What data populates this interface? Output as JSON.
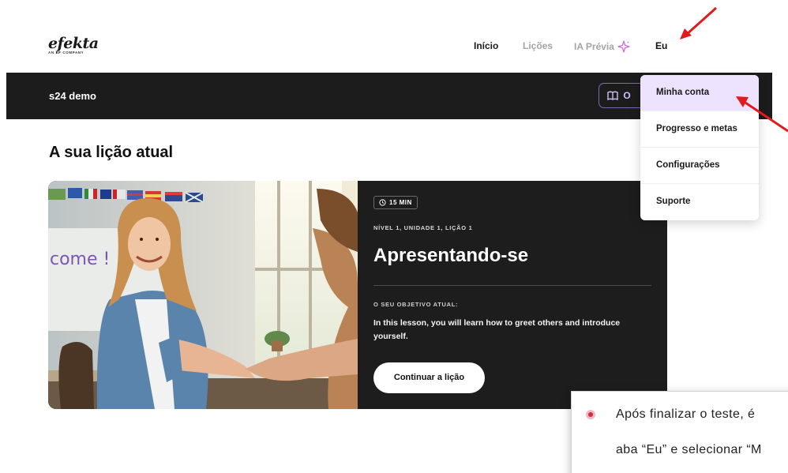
{
  "header": {
    "logo": {
      "word": "efekta",
      "tagline_prefix": "AN",
      "tagline_brand": "EF",
      "tagline_suffix": "COMPANY"
    },
    "nav": [
      {
        "label": "Início",
        "state": "active"
      },
      {
        "label": "Lições",
        "state": "inactive"
      },
      {
        "label": "IA Prévia",
        "state": "inactive",
        "icon": "sparkle-icon"
      },
      {
        "label": "Eu",
        "state": "open"
      }
    ]
  },
  "course_bar": {
    "name": "s24 demo",
    "book_button_label": "O",
    "book_icon": "book-icon"
  },
  "main": {
    "section_title": "A sua lição atual",
    "lesson": {
      "duration": "15 MIN",
      "level": "NÍVEL 1, UNIDADE 1, LIÇÃO 1",
      "title": "Apresentando-se",
      "objective_label": "O SEU OBJETIVO ATUAL:",
      "objective_text": "In this lesson, you will learn how to greet others and introduce yourself.",
      "cta_label": "Continuar a lição",
      "photo_wall_text": "come !"
    }
  },
  "dropdown": {
    "items": [
      {
        "label": "Minha conta",
        "highlighted": true
      },
      {
        "label": "Progresso e metas",
        "highlighted": false
      },
      {
        "label": "Configurações",
        "highlighted": false
      },
      {
        "label": "Suporte",
        "highlighted": false
      }
    ]
  },
  "annotation": {
    "line1": "Após finalizar o teste, é",
    "line2": "aba “Eu” e selecionar “M"
  },
  "colors": {
    "dark_bar": "#1c1c1c",
    "accent_purple": "#7d6bb0",
    "menu_highlight": "#eee3ff",
    "arrow_red": "#e11b1b"
  }
}
